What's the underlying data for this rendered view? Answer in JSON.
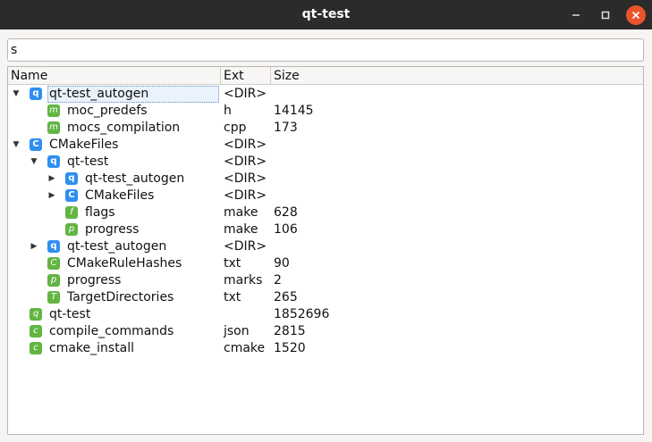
{
  "window": {
    "title": "qt-test"
  },
  "search": {
    "value": "s"
  },
  "columns": [
    "Name",
    "Ext",
    "Size"
  ],
  "rows": [
    {
      "name": "qt-test_autogen",
      "ext": "<DIR>",
      "size": "",
      "icon_letter": "q",
      "icon_color": "blue",
      "expand": "open",
      "depth": 0,
      "selected": true
    },
    {
      "name": "moc_predefs",
      "ext": "h",
      "size": "14145",
      "icon_letter": "m",
      "icon_color": "green",
      "expand": "none",
      "depth": 1
    },
    {
      "name": "mocs_compilation",
      "ext": "cpp",
      "size": "173",
      "icon_letter": "m",
      "icon_color": "green",
      "expand": "none",
      "depth": 1
    },
    {
      "name": "CMakeFiles",
      "ext": "<DIR>",
      "size": "",
      "icon_letter": "C",
      "icon_color": "blue",
      "expand": "open",
      "depth": 0
    },
    {
      "name": "qt-test",
      "ext": "<DIR>",
      "size": "",
      "icon_letter": "q",
      "icon_color": "blue",
      "expand": "open",
      "depth": 1
    },
    {
      "name": "qt-test_autogen",
      "ext": "<DIR>",
      "size": "",
      "icon_letter": "q",
      "icon_color": "blue",
      "expand": "closed",
      "depth": 2
    },
    {
      "name": "CMakeFiles",
      "ext": "<DIR>",
      "size": "",
      "icon_letter": "C",
      "icon_color": "blue",
      "expand": "closed",
      "depth": 2
    },
    {
      "name": "flags",
      "ext": "make",
      "size": "628",
      "icon_letter": "f",
      "icon_color": "green",
      "expand": "none",
      "depth": 2
    },
    {
      "name": "progress",
      "ext": "make",
      "size": "106",
      "icon_letter": "p",
      "icon_color": "green",
      "expand": "none",
      "depth": 2
    },
    {
      "name": "qt-test_autogen",
      "ext": "<DIR>",
      "size": "",
      "icon_letter": "q",
      "icon_color": "blue",
      "expand": "closed",
      "depth": 1
    },
    {
      "name": "CMakeRuleHashes",
      "ext": "txt",
      "size": "90",
      "icon_letter": "C",
      "icon_color": "green",
      "expand": "none",
      "depth": 1
    },
    {
      "name": "progress",
      "ext": "marks",
      "size": "2",
      "icon_letter": "p",
      "icon_color": "green",
      "expand": "none",
      "depth": 1
    },
    {
      "name": "TargetDirectories",
      "ext": "txt",
      "size": "265",
      "icon_letter": "T",
      "icon_color": "green",
      "expand": "none",
      "depth": 1
    },
    {
      "name": "qt-test",
      "ext": "",
      "size": "1852696",
      "icon_letter": "q",
      "icon_color": "green",
      "expand": "none",
      "depth": 0
    },
    {
      "name": "compile_commands",
      "ext": "json",
      "size": "2815",
      "icon_letter": "c",
      "icon_color": "green",
      "expand": "none",
      "depth": 0
    },
    {
      "name": "cmake_install",
      "ext": "cmake",
      "size": "1520",
      "icon_letter": "c",
      "icon_color": "green",
      "expand": "none",
      "depth": 0
    }
  ],
  "colors": {
    "icon_blue": "#2f8ff1",
    "icon_green": "#62b543",
    "close_button": "#e9542c",
    "titlebar": "#2b2b2b"
  }
}
